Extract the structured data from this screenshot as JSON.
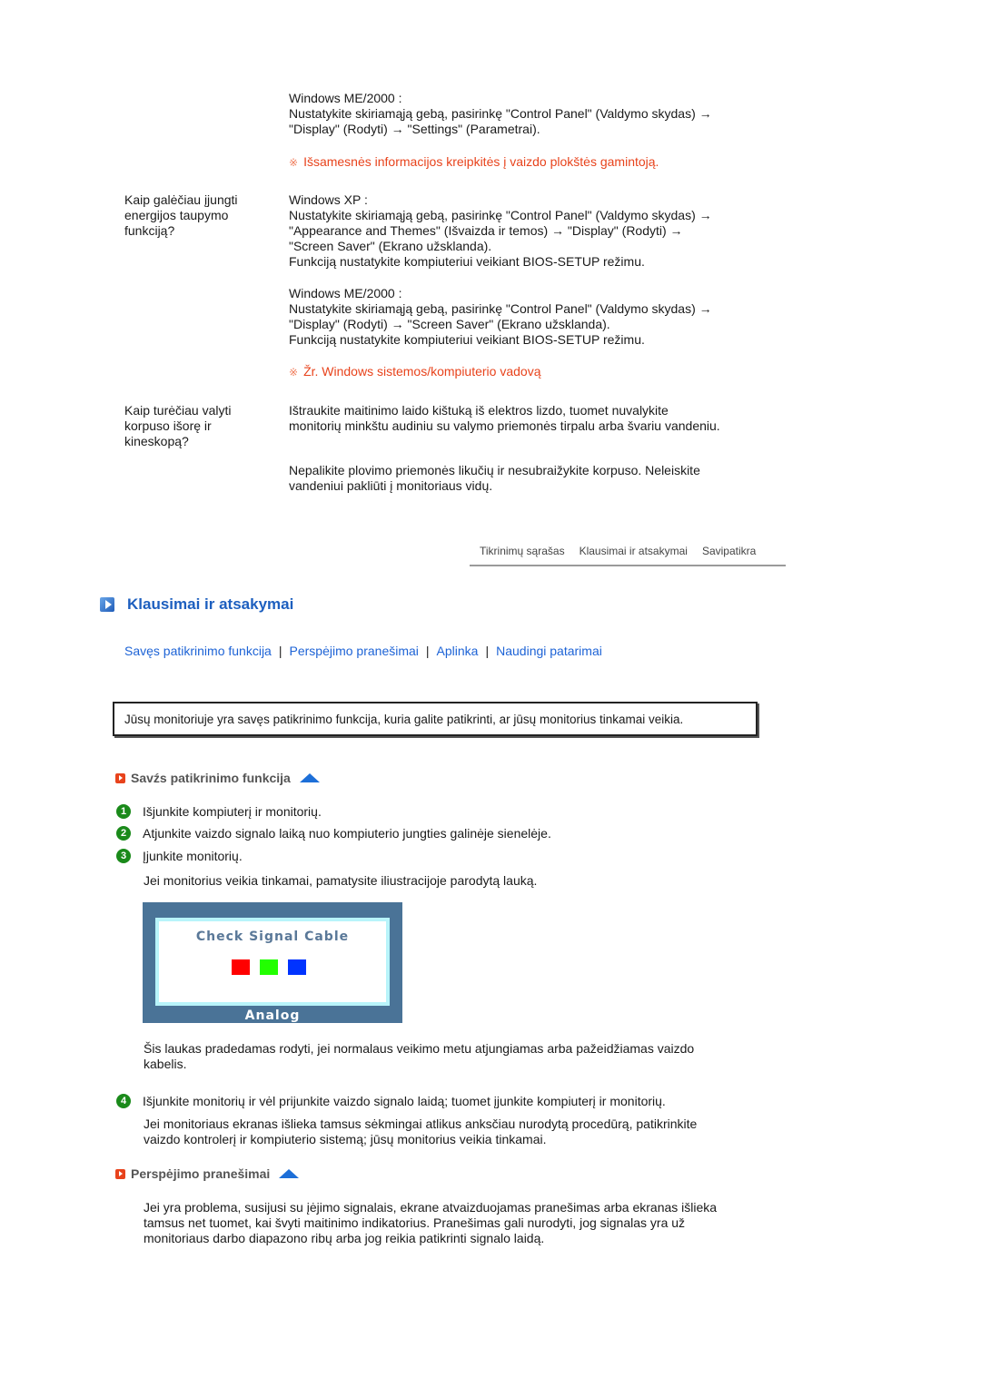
{
  "faq_top": {
    "me2000_a": {
      "label": "Windows ME/2000 :",
      "line1": "Nustatykite skiriamąją gebą, pasirinkę \"Control Panel\" (Valdymo skydas) →",
      "line2": "\"Display\" (Rodyti) → \"Settings\" (Parametrai)."
    },
    "note1": "Išsamesnės informacijos kreipkitės į vaizdo plokštės gamintoją.",
    "q2": {
      "question": [
        "Kaip galėčiau įjungti",
        "energijos taupymo",
        "funkciją?"
      ],
      "xp_label": "Windows XP :",
      "xp_lines": [
        "Nustatykite skiriamąją gebą, pasirinkę \"Control Panel\" (Valdymo skydas) →",
        "\"Appearance and Themes\" (Išvaizda ir temos) → \"Display\" (Rodyti) →",
        "\"Screen Saver\" (Ekrano užsklanda).",
        "Funkciją nustatykite kompiuteriui veikiant BIOS-SETUP režimu."
      ],
      "me_label": "Windows ME/2000 :",
      "me_lines": [
        "Nustatykite skiriamąją gebą, pasirinkę \"Control Panel\" (Valdymo skydas) →",
        "\"Display\" (Rodyti) → \"Screen Saver\" (Ekrano užsklanda).",
        "Funkciją nustatykite kompiuteriui veikiant BIOS-SETUP režimu."
      ],
      "note": "Žr. Windows sistemos/kompiuterio vadovą"
    },
    "q3": {
      "question": [
        "Kaip turėčiau valyti",
        "korpuso išorę ir",
        "kineskopą?"
      ],
      "answer1": [
        "Ištraukite maitinimo laido kištuką iš elektros lizdo, tuomet nuvalykite",
        "monitorių minkštu audiniu su valymo priemonės tirpalu arba švariu vandeniu."
      ],
      "answer2": [
        "Nepalikite plovimo priemonės likučių ir nesubraižykite korpuso. Neleiskite",
        "vandeniui pakliūti į monitoriaus vidų."
      ]
    },
    "note_mark": "※"
  },
  "tabs": [
    "Tikrinimų sąrašas",
    "Klausimai ir atsakymai",
    "Savipatikra"
  ],
  "section": {
    "title": "Klausimai ir atsakymai",
    "links": [
      "Savęs patikrinimo funkcija",
      "Perspėjimo pranešimai",
      "Aplinka",
      "Naudingi patarimai"
    ],
    "separator": "|",
    "intro_box": "Jūsų monitoriuje yra savęs patikrinimo funkcija, kuria galite patikrinti, ar jūsų monitorius tinkamai veikia."
  },
  "selftest": {
    "heading": "Savźs patikrinimo funkcija",
    "steps": [
      {
        "num": "1",
        "text": "Išjunkite kompiuterį ir monitorių."
      },
      {
        "num": "2",
        "text": "Atjunkite vaizdo signalo laiką nuo kompiuterio jungties galinėje sienelėje."
      },
      {
        "num": "3",
        "text": "Įjunkite monitorių."
      }
    ],
    "after_step3": "Jei monitorius veikia tinkamai, pamatysite iliustracijoje parodytą lauką.",
    "osd": {
      "title": "Check Signal Cable",
      "label": "Analog",
      "swatches": [
        "#ff0000",
        "#22ff00",
        "#0033ff"
      ]
    },
    "osd_caption": [
      "Šis laukas pradedamas rodyti, jei normalaus veikimo metu atjungiamas arba pažeidžiamas vaizdo",
      "kabelis."
    ],
    "step4": {
      "num": "4",
      "text": "Išjunkite monitorių ir vėl prijunkite vaizdo signalo laidą; tuomet įjunkite kompiuterį ir monitorių."
    },
    "after_step4": [
      "Jei monitoriaus ekranas išlieka tamsus sėkmingai atlikus anksčiau nurodytą procedūrą, patikrinkite",
      "vaizdo kontrolerį ir kompiuterio sistemą; jūsų monitorius veikia tinkamai."
    ]
  },
  "warnings": {
    "heading": "Perspėjimo pranešimai",
    "text": [
      "Jei yra problema, susijusi su įėjimo signalais, ekrane atvaizduojamas pranešimas arba ekranas išlieka",
      "tamsus net tuomet, kai švyti maitinimo indikatorius. Pranešimas gali nurodyti, jog signalas yra už",
      "monitoriaus darbo diapazono ribų arba jog reikia patikrinti signalo laidą."
    ]
  },
  "colors": {
    "accent_blue": "#1d63d6",
    "note_orange": "#e8431c",
    "step_green": "#1a8a1a"
  }
}
